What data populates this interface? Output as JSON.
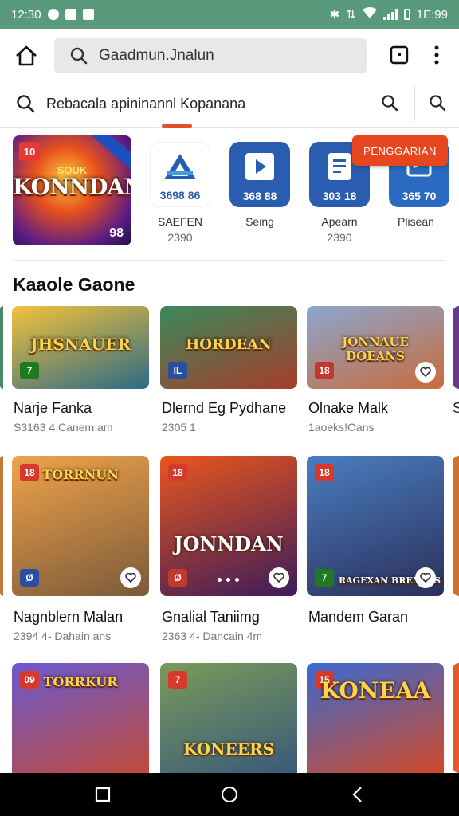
{
  "status_bar": {
    "time": "12:30",
    "right_time": "1E:99"
  },
  "app_bar": {
    "search_text": "Gaadmun.Jnalun"
  },
  "search_row": {
    "query": "Rebacala apininannl Kopanana"
  },
  "featured": {
    "badge": "10",
    "title": "KONNDAN",
    "subtitle": "SOUK",
    "corner_num": "98"
  },
  "promo_button": {
    "label": "PENGGARIAN"
  },
  "apps": [
    {
      "code": "3698 86",
      "name": "SAEFEN",
      "sub": "2390",
      "color": "#ffffff",
      "icon": "triangle-logo-icon"
    },
    {
      "code": "368 88",
      "name": "Seing",
      "sub": "",
      "color": "#2a5db0",
      "icon": "play-icon"
    },
    {
      "code": "303 18",
      "name": "Apearn",
      "sub": "2390",
      "color": "#2a5db0",
      "icon": "document-icon"
    },
    {
      "code": "365 70",
      "name": "Plisean",
      "sub": "",
      "color": "#2a6ac0",
      "icon": "resize-icon"
    }
  ],
  "section": {
    "title": "Kaaole Gaone"
  },
  "games": [
    {
      "title": "Narje Fanka",
      "sub": "S3163 4  Canem am",
      "tag": "7",
      "tag_color": "#1f7a1f",
      "logo": "JHSNAUER",
      "c1": "#f2c23a",
      "c2": "#2d6a86"
    },
    {
      "title": "Dlernd Eg Pydhane",
      "sub": "2305 1",
      "tag": "IL",
      "tag_color": "#2a4fa0",
      "logo": "HORDEAN",
      "c1": "#3a8a5b",
      "c2": "#a63d2c"
    },
    {
      "title": "Olnake Malk",
      "sub": "1aoeks!Oans",
      "tag": "18",
      "tag_color": "#c0392b",
      "logo": "JONNAUE DOEANS",
      "c1": "#8aa7d0",
      "c2": "#c96b3a"
    },
    {
      "title": "Nagnblern Malan",
      "sub": "2394 4-  Dahain ans",
      "tag": "18",
      "tag_color": "#d73a2c",
      "logo": "TORRNUN",
      "c1": "#f0a34a",
      "c2": "#7b5a3a"
    },
    {
      "title": "Gnalial Taniimg",
      "sub": "2363 4-  Dancain 4m",
      "tag": "18",
      "tag_color": "#d73a2c",
      "logo": "JONNDAN",
      "c1": "#e8561d",
      "c2": "#3d1c5a"
    },
    {
      "title": "Mandem Garan",
      "sub": "",
      "tag": "18",
      "tag_color": "#d73a2c",
      "logo": "RAGEXAN BRENCES",
      "c1": "#4a7ec0",
      "c2": "#2b2f5a"
    },
    {
      "title": "",
      "sub": "",
      "tag": "09",
      "tag_color": "#d73a2c",
      "logo": "TORRKUR",
      "c1": "#6a5ad0",
      "c2": "#c04a3a"
    },
    {
      "title": "",
      "sub": "",
      "tag": "7",
      "tag_color": "#d73a2c",
      "logo": "KONEERS",
      "c1": "#7a9a5a",
      "c2": "#3a5a7a"
    },
    {
      "title": "",
      "sub": "",
      "tag": "15",
      "tag_color": "#d73a2c",
      "logo": "KONEAA",
      "c1": "#3a6ad0",
      "c2": "#d04a2a"
    }
  ]
}
